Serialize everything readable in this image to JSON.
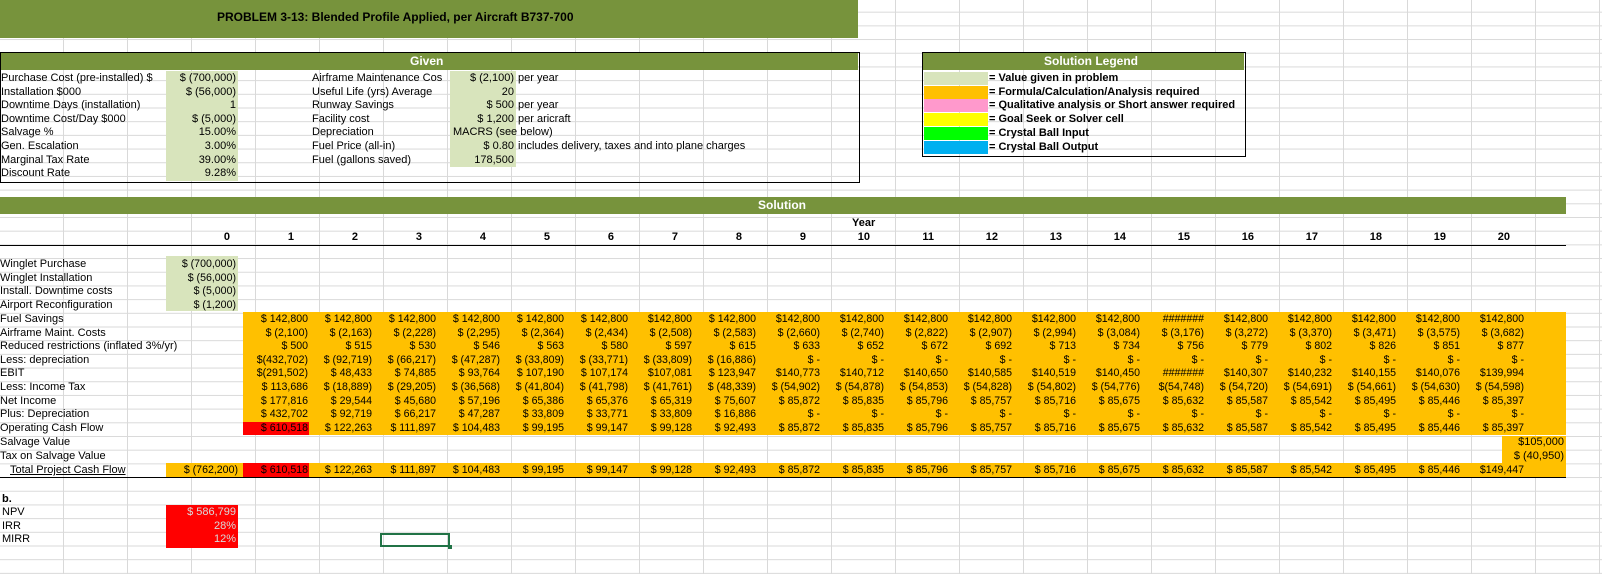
{
  "title": "PROBLEM 3-13: Blended Profile Applied, per Aircraft B737-700",
  "given": {
    "header": "Given",
    "left": [
      {
        "label": "Purchase Cost (pre-installed) $",
        "value": "$  (700,000)"
      },
      {
        "label": "Installation $000",
        "value": "$    (56,000)"
      },
      {
        "label": "Downtime Days (installation)",
        "value": "1"
      },
      {
        "label": "Downtime Cost/Day $000",
        "value": "$      (5,000)"
      },
      {
        "label": "Salvage %",
        "value": "15.00%"
      },
      {
        "label": "Gen. Escalation",
        "value": "3.00%"
      },
      {
        "label": "Marginal Tax Rate",
        "value": "39.00%"
      },
      {
        "label": "Discount Rate",
        "value": "9.28%"
      }
    ],
    "right": [
      {
        "label": "Airframe Maintenance Cos",
        "value": "$   (2,100)",
        "note": "per year"
      },
      {
        "label": "Useful Life (yrs) Average",
        "value": "20",
        "note": ""
      },
      {
        "label": "Runway Savings",
        "value": "$       500",
        "note": "per year"
      },
      {
        "label": "Facility cost",
        "value": "$    1,200",
        "note": "per aricraft"
      },
      {
        "label": "Depreciation",
        "value": "MACRS (see below)",
        "note": ""
      },
      {
        "label": "Fuel Price (all-in)",
        "value": "$       0.80",
        "note": "includes delivery, taxes and into plane charges"
      },
      {
        "label": "Fuel (gallons saved)",
        "value": "178,500",
        "note": ""
      }
    ]
  },
  "legend": {
    "header": "Solution Legend",
    "items": [
      {
        "color": "#d8e4bc",
        "text": "= Value given in problem"
      },
      {
        "color": "#ffc000",
        "text": "= Formula/Calculation/Analysis required"
      },
      {
        "color": "#ff99cc",
        "text": "= Qualitative analysis or Short answer required"
      },
      {
        "color": "#ffff00",
        "text": "= Goal Seek or Solver cell"
      },
      {
        "color": "#00ff00",
        "text": "= Crystal Ball Input"
      },
      {
        "color": "#00b0f0",
        "text": "= Crystal Ball Output"
      }
    ]
  },
  "solution": {
    "header": "Solution",
    "year_label": "Year",
    "years": [
      "0",
      "1",
      "2",
      "3",
      "4",
      "5",
      "6",
      "7",
      "8",
      "9",
      "10",
      "11",
      "12",
      "13",
      "14",
      "15",
      "16",
      "17",
      "18",
      "19",
      "20"
    ],
    "year0_rows": [
      {
        "label": "Winglet Purchase",
        "value": "$ (700,000)"
      },
      {
        "label": "Winglet Installation",
        "value": "$   (56,000)"
      },
      {
        "label": "Install. Downtime costs",
        "value": "$     (5,000)"
      },
      {
        "label": "Airport Reconfiguration",
        "value": "$     (1,200)"
      }
    ],
    "rows": [
      {
        "label": "Fuel Savings",
        "values": [
          "$ 142,800",
          "$ 142,800",
          "$ 142,800",
          "$ 142,800",
          "$ 142,800",
          "$ 142,800",
          "$142,800",
          "$ 142,800",
          "$142,800",
          "$142,800",
          "$142,800",
          "$142,800",
          "$142,800",
          "$142,800",
          "#######",
          "$142,800",
          "$142,800",
          "$142,800",
          "$142,800",
          "$142,800"
        ]
      },
      {
        "label": "Airframe Maint. Costs",
        "values": [
          "$ (2,100)",
          "$ (2,163)",
          "$ (2,228)",
          "$ (2,295)",
          "$ (2,364)",
          "$ (2,434)",
          "$ (2,508)",
          "$ (2,583)",
          "$ (2,660)",
          "$ (2,740)",
          "$ (2,822)",
          "$ (2,907)",
          "$ (2,994)",
          "$ (3,084)",
          "$ (3,176)",
          "$ (3,272)",
          "$ (3,370)",
          "$ (3,471)",
          "$ (3,575)",
          "$ (3,682)"
        ]
      },
      {
        "label": "Reduced restrictions (inflated 3%/yr)",
        "values": [
          "$ 500",
          "$ 515",
          "$ 530",
          "$ 546",
          "$ 563",
          "$ 580",
          "$ 597",
          "$ 615",
          "$ 633",
          "$ 652",
          "$ 672",
          "$ 692",
          "$ 713",
          "$ 734",
          "$ 756",
          "$ 779",
          "$ 802",
          "$ 826",
          "$ 851",
          "$ 877"
        ]
      },
      {
        "label": "Less: depreciation",
        "values": [
          "$(432,702)",
          "$ (92,719)",
          "$ (66,217)",
          "$ (47,287)",
          "$ (33,809)",
          "$ (33,771)",
          "$ (33,809)",
          "$ (16,886)",
          "$ -",
          "$ -",
          "$ -",
          "$ -",
          "$ -",
          "$ -",
          "$ -",
          "$ -",
          "$ -",
          "$ -",
          "$ -",
          "$ -"
        ]
      },
      {
        "label": "   EBIT",
        "values": [
          "$(291,502)",
          "$ 48,433",
          "$ 74,885",
          "$ 93,764",
          "$ 107,190",
          "$ 107,174",
          "$107,081",
          "$ 123,947",
          "$140,773",
          "$140,712",
          "$140,650",
          "$140,585",
          "$140,519",
          "$140,450",
          "#######",
          "$140,307",
          "$140,232",
          "$140,155",
          "$140,076",
          "$139,994"
        ]
      },
      {
        "label": "Less:  Income Tax",
        "values": [
          "$ 113,686",
          "$ (18,889)",
          "$ (29,205)",
          "$ (36,568)",
          "$ (41,804)",
          "$ (41,798)",
          "$ (41,761)",
          "$ (48,339)",
          "$ (54,902)",
          "$ (54,878)",
          "$ (54,853)",
          "$ (54,828)",
          "$ (54,802)",
          "$ (54,776)",
          "$(54,748)",
          "$ (54,720)",
          "$ (54,691)",
          "$ (54,661)",
          "$ (54,630)",
          "$ (54,598)"
        ]
      },
      {
        "label": "   Net Income",
        "values": [
          "$ 177,816",
          "$ 29,544",
          "$ 45,680",
          "$ 57,196",
          "$ 65,386",
          "$ 65,376",
          "$ 65,319",
          "$ 75,607",
          "$ 85,872",
          "$ 85,835",
          "$ 85,796",
          "$ 85,757",
          "$ 85,716",
          "$ 85,675",
          "$ 85,632",
          "$ 85,587",
          "$ 85,542",
          "$ 85,495",
          "$ 85,446",
          "$ 85,397"
        ]
      },
      {
        "label": "Plus:  Depreciation",
        "values": [
          "$ 432,702",
          "$ 92,719",
          "$ 66,217",
          "$ 47,287",
          "$ 33,809",
          "$ 33,771",
          "$ 33,809",
          "$ 16,886",
          "$ -",
          "$ -",
          "$ -",
          "$ -",
          "$ -",
          "$ -",
          "$ -",
          "$ -",
          "$ -",
          "$ -",
          "$ -",
          "$ -"
        ]
      },
      {
        "label": "   Operating Cash Flow",
        "values": [
          "$ 610,518",
          "$ 122,263",
          "$ 111,897",
          "$ 104,483",
          "$ 99,195",
          "$ 99,147",
          "$ 99,128",
          "$ 92,493",
          "$ 85,872",
          "$ 85,835",
          "$ 85,796",
          "$ 85,757",
          "$ 85,716",
          "$ 85,675",
          "$ 85,632",
          "$ 85,587",
          "$ 85,542",
          "$ 85,495",
          "$ 85,446",
          "$ 85,397"
        ]
      }
    ],
    "salvage_label": "Salvage Value",
    "salvage_value": "$105,000",
    "tax_salvage_label": "Tax on Salvage Value",
    "tax_salvage_value": "$ (40,950)",
    "total_label": "Total Project Cash Flow",
    "total_year0": "$ (762,200)",
    "total_values": [
      "$ 610,518",
      "$ 122,263",
      "$ 111,897",
      "$ 104,483",
      "$ 99,195",
      "$ 99,147",
      "$ 99,128",
      "$ 92,493",
      "$ 85,872",
      "$ 85,835",
      "$ 85,796",
      "$ 85,757",
      "$ 85,716",
      "$ 85,675",
      "$ 85,632",
      "$ 85,587",
      "$ 85,542",
      "$ 85,495",
      "$ 85,446",
      "$149,447"
    ]
  },
  "part_b": {
    "label": "b.",
    "rows": [
      {
        "label": "NPV",
        "value": "$ 586,799"
      },
      {
        "label": "IRR",
        "value": "28%"
      },
      {
        "label": "MIRR",
        "value": "12%"
      }
    ]
  }
}
